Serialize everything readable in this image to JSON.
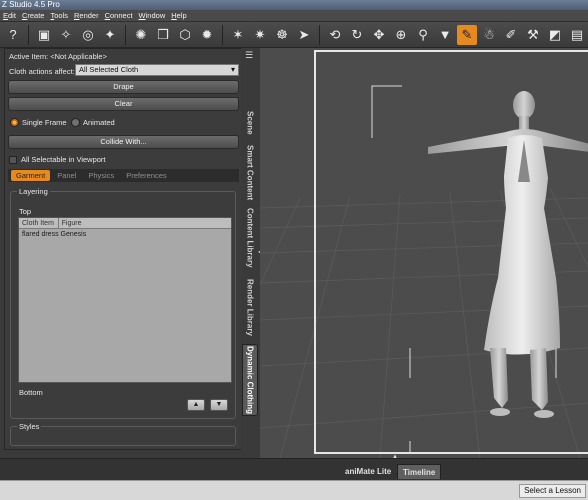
{
  "app": {
    "title": "Z Studio 4.5 Pro"
  },
  "menu": [
    "Edit",
    "Create",
    "Tools",
    "Render",
    "Connect",
    "Window",
    "Help"
  ],
  "toolbar": {
    "icons": [
      "help-icon",
      "scene-icon",
      "wand-icon",
      "globe-icon",
      "star-icon",
      "light-icon",
      "cube-icon",
      "cube-outline-icon",
      "light-icon",
      "bulb-icon",
      "spot-light-icon",
      "star-icon",
      "figure-icon",
      "arrow-icon",
      "orbit-icon",
      "rotate-icon",
      "move-icon",
      "universal-tool-icon",
      "joint-icon",
      "pin-icon",
      "paint-icon",
      "figure-pose-icon",
      "magic-icon",
      "node-icon",
      "surface-icon",
      "camera-icon"
    ],
    "active_icon": "paint-icon",
    "accent": "#e68a1f"
  },
  "pane": {
    "active_item": "Active Item: <Not Applicable>",
    "cloth_actions_label": "Cloth actions affect:",
    "cloth_actions_value": "All Selected Cloth",
    "drape": "Drape",
    "clear": "Clear",
    "single_frame": "Single Frame",
    "animated": "Animated",
    "collide": "Collide With...",
    "all_selectable": "All Selectable in Viewport",
    "subtabs": [
      "Garment",
      "Panel",
      "Physics",
      "Preferences"
    ],
    "layering": {
      "title": "Layering",
      "top": "Top",
      "bottom": "Bottom",
      "columns": [
        "Cloth Item",
        "Figure"
      ],
      "rows": [
        [
          "flared dress",
          "Genesis"
        ]
      ]
    },
    "styles": "Styles"
  },
  "vtabs": [
    "Scene",
    "Smart Content",
    "Content Library",
    "Render Library",
    "Dynamic Clothing"
  ],
  "viewport": {
    "label": "..."
  },
  "bottom_tabs": [
    "aniMate Lite",
    "Timeline"
  ],
  "status": {
    "lesson_button": "Select a Lesson"
  }
}
